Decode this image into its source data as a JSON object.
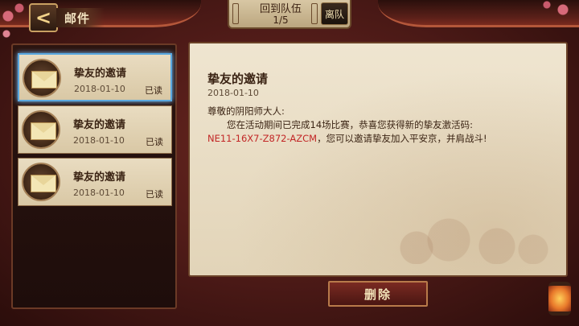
{
  "header": {
    "back_glyph": "<",
    "title": "邮件"
  },
  "team": {
    "return_label": "回到队伍",
    "count": "1/5",
    "leave_label": "离队"
  },
  "mail_list": [
    {
      "subject": "挚友的邀请",
      "date": "2018-01-10",
      "status": "已读",
      "icon": "envelope-icon"
    },
    {
      "subject": "挚友的邀请",
      "date": "2018-01-10",
      "status": "已读",
      "icon": "envelope-icon"
    },
    {
      "subject": "挚友的邀请",
      "date": "2018-01-10",
      "status": "已读",
      "icon": "envelope-icon"
    }
  ],
  "detail": {
    "title": "挚友的邀请",
    "date": "2018-01-10",
    "greeting": "尊敬的阴阳师大人:",
    "line1": "您在活动期间已完成14场比赛，恭喜您获得新的挚友激活码:",
    "code": "NE11-16X7-Z872-AZCM",
    "line2": "，您可以邀请挚友加入平安京，并肩战斗!"
  },
  "actions": {
    "delete_label": "删除"
  },
  "colors": {
    "code_text": "#c22626",
    "selected_border": "#5aa8e0"
  }
}
